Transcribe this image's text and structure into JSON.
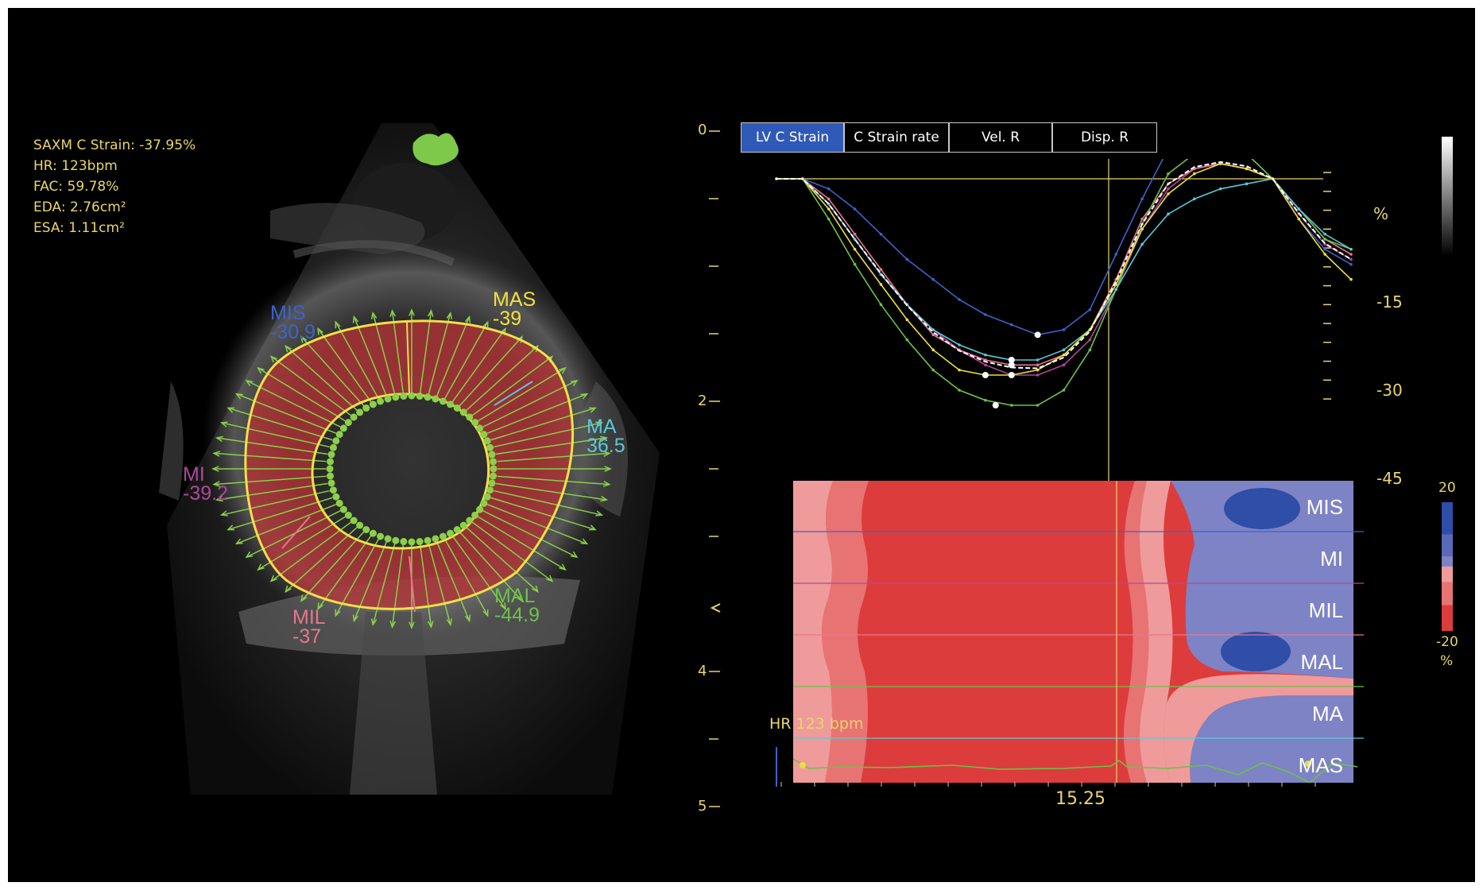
{
  "measurements": {
    "strain": "SAXM C Strain: -37.95%",
    "hr": "HR:   123bpm",
    "fac": "FAC: 59.78%",
    "eda": "EDA: 2.76cm²",
    "esa": "ESA: 1.11cm²"
  },
  "segments": [
    {
      "name": "MIS",
      "value": "-30.9",
      "color": "#3d63c9"
    },
    {
      "name": "MAS",
      "value": "-39",
      "color": "#f2e13c"
    },
    {
      "name": "MA",
      "value": "36.5",
      "color": "#5bc8d8"
    },
    {
      "name": "MI",
      "value": "-39.2",
      "color": "#b0489a"
    },
    {
      "name": "MIL",
      "value": "-37",
      "color": "#e8768e"
    },
    {
      "name": "MAL",
      "value": "-44.9",
      "color": "#6bc24a"
    }
  ],
  "tabs": [
    {
      "label": "LV C Strain",
      "active": true
    },
    {
      "label": "C Strain rate",
      "active": false
    },
    {
      "label": "Vel. R",
      "active": false
    },
    {
      "label": "Disp. R",
      "active": false
    }
  ],
  "depth_scale": {
    "labels": [
      "0",
      "2",
      "4",
      "5"
    ]
  },
  "strain_axis": {
    "unit": "%",
    "ticks": [
      "-15",
      "-30",
      "-45"
    ]
  },
  "heatmap": {
    "rows": [
      "MIS",
      "MI",
      "MIL",
      "MAL",
      "MA",
      "MAS"
    ],
    "colorbar_max": "20",
    "colorbar_min": "-20",
    "colorbar_unit": "%"
  },
  "ecg": {
    "hr_label": "HR 123 bpm"
  },
  "time_label": "15.25",
  "colors": {
    "accent_yellow": "#e8d66a",
    "active_tab": "#2f59b7",
    "strain_red": "#d9393a",
    "strain_blue": "#7d83c4"
  },
  "chart_data": {
    "type": "line",
    "title": "LV C Strain",
    "ylabel": "%",
    "ylim": [
      -45,
      5
    ],
    "yticks": [
      -15,
      -30,
      -45
    ],
    "x": [
      0,
      1,
      2,
      3,
      4,
      5,
      6,
      7,
      8,
      9,
      10,
      11,
      12,
      13,
      14,
      15,
      16,
      17,
      18,
      19,
      20,
      21,
      22
    ],
    "series": [
      {
        "name": "MIS",
        "color": "#3d63c9",
        "values": [
          0,
          0,
          -2,
          -6,
          -11,
          -16,
          -20,
          -24,
          -27,
          -29,
          -31,
          -30,
          -26,
          -15,
          -4,
          6,
          8,
          7,
          5,
          0,
          -8,
          -14,
          -17
        ]
      },
      {
        "name": "MI",
        "color": "#b0489a",
        "values": [
          0,
          0,
          -5,
          -12,
          -19,
          -25,
          -30,
          -34,
          -37,
          -39,
          -39,
          -37,
          -32,
          -22,
          -10,
          -2,
          2,
          3,
          2,
          0,
          -7,
          -13,
          -16
        ]
      },
      {
        "name": "MIL",
        "color": "#e8768e",
        "values": [
          0,
          0,
          -4,
          -11,
          -18,
          -25,
          -31,
          -34,
          -36,
          -37,
          -37,
          -35,
          -30,
          -20,
          -8,
          -1,
          2,
          3,
          2,
          0,
          -6,
          -12,
          -15
        ]
      },
      {
        "name": "MAL",
        "color": "#6bc24a",
        "values": [
          0,
          0,
          -8,
          -17,
          -25,
          -32,
          -38,
          -42,
          -44,
          -45,
          -45,
          -42,
          -34,
          -22,
          -9,
          1,
          5,
          6,
          5,
          0,
          -6,
          -12,
          -14
        ]
      },
      {
        "name": "MA",
        "color": "#5bc8d8",
        "values": [
          0,
          0,
          -5,
          -12,
          -19,
          -25,
          -30,
          -33,
          -35,
          -36,
          -36,
          -34,
          -30,
          -22,
          -13,
          -7,
          -4,
          -2,
          -1,
          0,
          -6,
          -11,
          -14
        ]
      },
      {
        "name": "MAS",
        "color": "#f2e13c",
        "values": [
          0,
          0,
          -6,
          -14,
          -21,
          -28,
          -34,
          -38,
          -39,
          -39,
          -38,
          -35,
          -30,
          -21,
          -10,
          -3,
          1,
          3,
          2,
          0,
          -8,
          -15,
          -20
        ]
      }
    ]
  }
}
